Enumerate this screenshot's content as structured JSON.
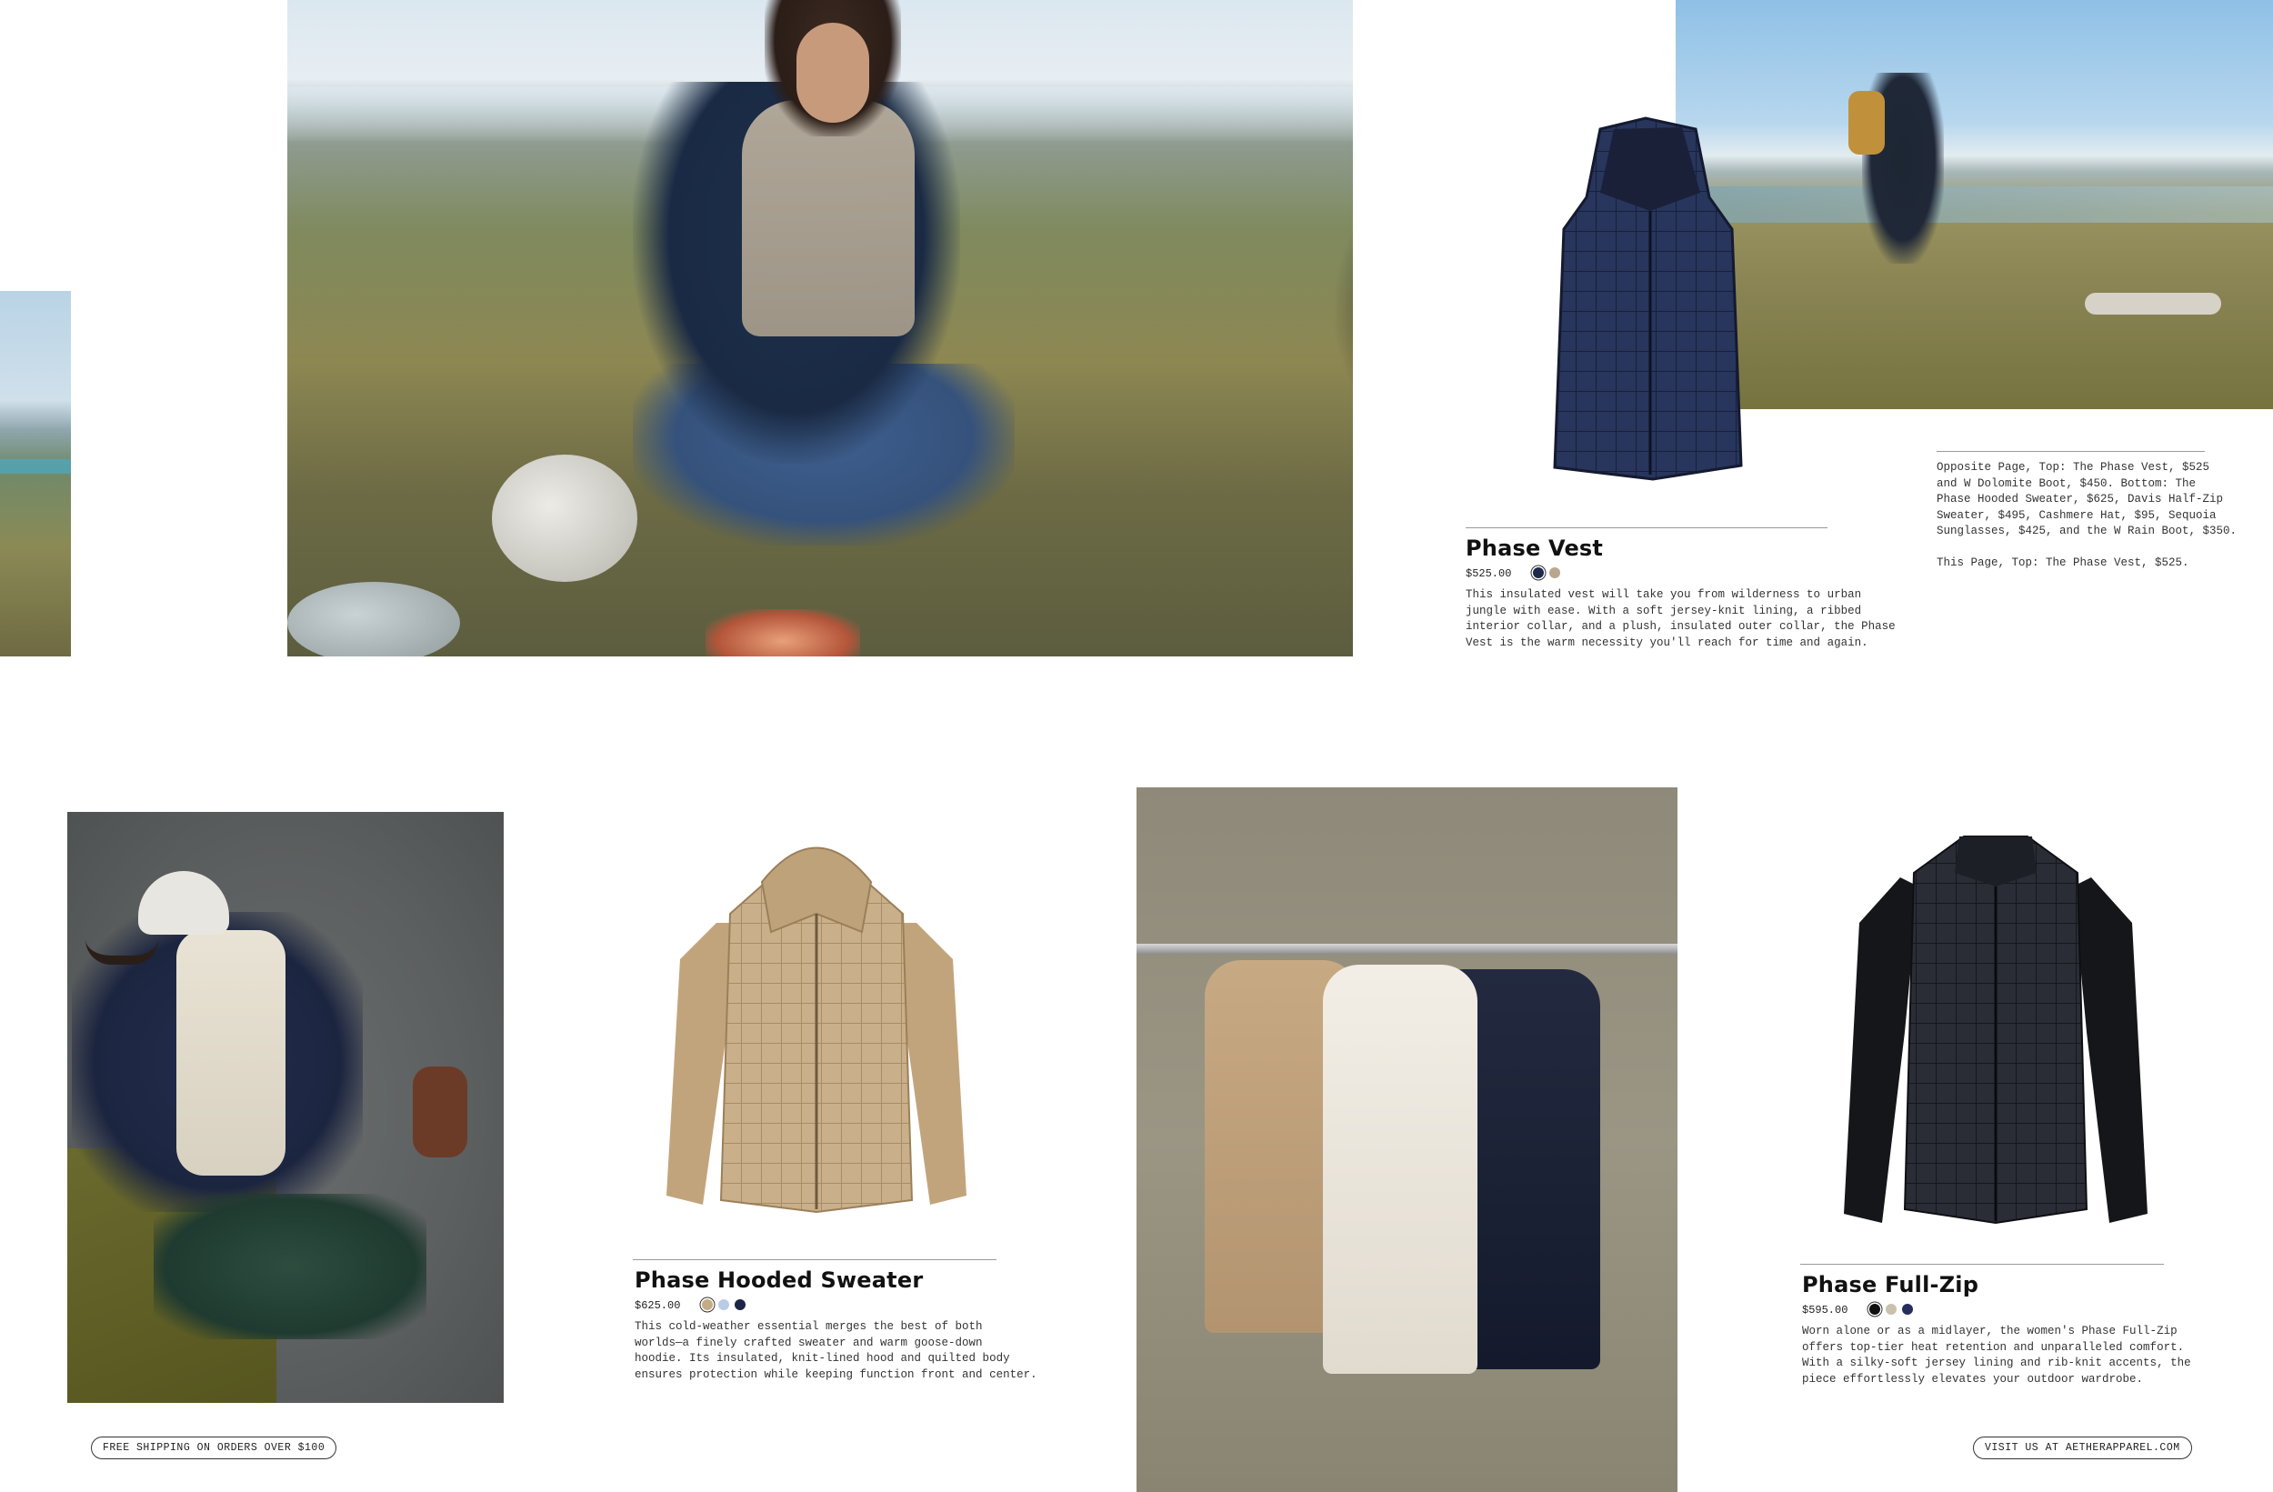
{
  "products": [
    {
      "id": "phase-vest",
      "name": "Phase Vest",
      "price": "$525.00",
      "swatches": [
        "#1f2a4a",
        "#b8a78e"
      ],
      "selected_swatch": 0,
      "description": "This insulated vest will take you from wilderness to urban\njungle with ease. With a soft jersey-knit lining, a ribbed\ninterior collar, and a plush, insulated outer collar, the Phase\nVest is the warm necessity you'll reach for time and again."
    },
    {
      "id": "phase-hooded-sweater",
      "name": "Phase Hooded Sweater",
      "price": "$625.00",
      "swatches": [
        "#c4ab86",
        "#b9cce6",
        "#1c2646"
      ],
      "selected_swatch": 0,
      "description": "This cold-weather essential merges the best of both\nworlds—a finely crafted sweater and warm goose-down\nhoodie. Its insulated, knit-lined hood and quilted body\nensures protection while keeping function front and center."
    },
    {
      "id": "phase-full-zip",
      "name": "Phase Full-Zip",
      "price": "$595.00",
      "swatches": [
        "#111111",
        "#c9c1ad",
        "#24305a"
      ],
      "selected_swatch": 0,
      "description": "Worn alone or as a midlayer, the women's Phase Full-Zip\noffers top-tier heat retention and unparalleled comfort.\nWith a silky-soft jersey lining and rib-knit accents, the\npiece effortlessly elevates your outdoor wardrobe."
    }
  ],
  "caption": {
    "text": "Opposite Page, Top: The Phase Vest, $525\nand W Dolomite Boot, $450. Bottom: The\nPhase Hooded Sweater, $625, Davis Half-Zip\nSweater, $495, Cashmere Hat, $95, Sequoia\nSunglasses, $425, and the W Rain Boot, $350.\n\nThis Page, Top: The Phase Vest, $525."
  },
  "footer": {
    "shipping": "FREE SHIPPING ON ORDERS OVER $100",
    "visit": "VISIT US AT AETHERAPPAREL.COM"
  },
  "colors": {
    "rule": "#9a9a9a",
    "text": "#333333",
    "navy": "#1f2a4a",
    "tan": "#c4ab86",
    "black": "#111111"
  }
}
